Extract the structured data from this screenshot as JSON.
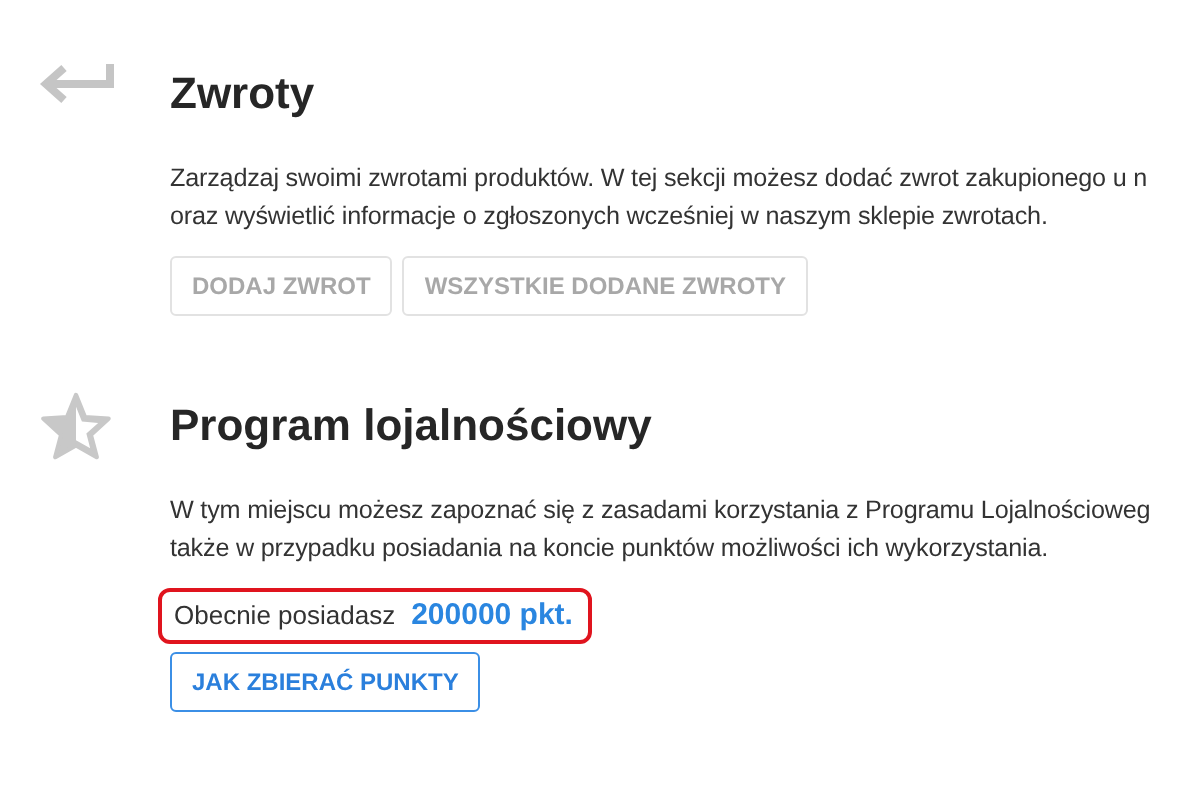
{
  "sections": [
    {
      "kind": "returns",
      "title": "Zwroty",
      "description_lines": [
        "Zarządzaj swoimi zwrotami produktów. W tej sekcji możesz dodać zwrot zakupionego u n",
        "oraz wyświetlić informacje o zgłoszonych wcześniej w naszym sklepie zwrotach."
      ],
      "buttons": [
        {
          "label": "DODAJ ZWROT",
          "disabled": true
        },
        {
          "label": "WSZYSTKIE DODANE ZWROTY",
          "disabled": true
        }
      ]
    },
    {
      "kind": "loyalty",
      "title": "Program lojalnościowy",
      "description_lines": [
        "W tym miejscu możesz zapoznać się z zasadami korzystania z Programu Lojalnościoweg",
        "także w przypadku posiadania na koncie punktów możliwości ich wykorzystania."
      ],
      "points": {
        "label": "Obecnie posiadasz",
        "value": "200000 pkt.",
        "highlighted": true
      },
      "buttons": [
        {
          "label": "JAK ZBIERAĆ PUNKTY",
          "disabled": false
        }
      ]
    }
  ]
}
